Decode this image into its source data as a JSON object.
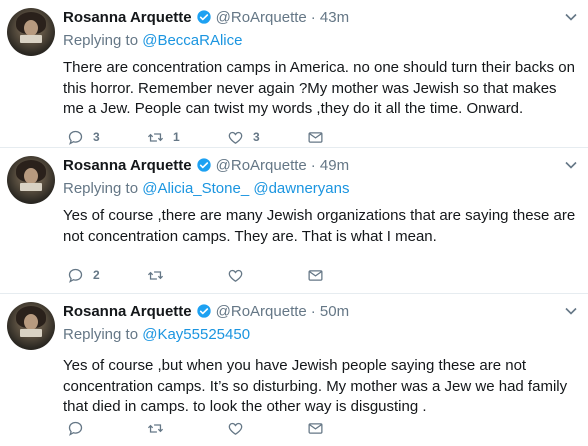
{
  "tweets": [
    {
      "name": "Rosanna Arquette",
      "handle": "@RoArquette",
      "time": "· 43m",
      "replying_to_label": "Replying to",
      "mentions": [
        "@BeccaRAlice"
      ],
      "text": "There are concentration camps in America. no one should turn their backs on this horror. Remember never again ?My mother was Jewish so that makes me a Jew.   People can twist my words ,they do it all the time. Onward.",
      "counts": {
        "reply": "3",
        "retweet": "1",
        "like": "3"
      }
    },
    {
      "name": "Rosanna Arquette",
      "handle": "@RoArquette",
      "time": "· 49m",
      "replying_to_label": "Replying to",
      "mentions": [
        "@Alicia_Stone_",
        "@dawneryans"
      ],
      "text": "Yes of course ,there are many Jewish organizations that are saying these are not concentration camps.  They are.  That is what I mean.",
      "counts": {
        "reply": "2",
        "retweet": "",
        "like": ""
      }
    },
    {
      "name": "Rosanna Arquette",
      "handle": "@RoArquette",
      "time": "· 50m",
      "replying_to_label": "Replying to",
      "mentions": [
        "@Kay55525450"
      ],
      "text": "Yes of course ,but when you have Jewish people saying these are not concentration camps. It’s so disturbing. My mother was a Jew  we had family that died in camps. to look the other way is disgusting .",
      "counts": {
        "reply": "",
        "retweet": "",
        "like": ""
      }
    }
  ],
  "colors": {
    "link": "#1b95e0",
    "muted": "#657786",
    "verified": "#1da1f2"
  },
  "icons": [
    "verified-badge-icon",
    "caret-down-icon",
    "reply-icon",
    "retweet-icon",
    "like-icon",
    "message-icon"
  ]
}
